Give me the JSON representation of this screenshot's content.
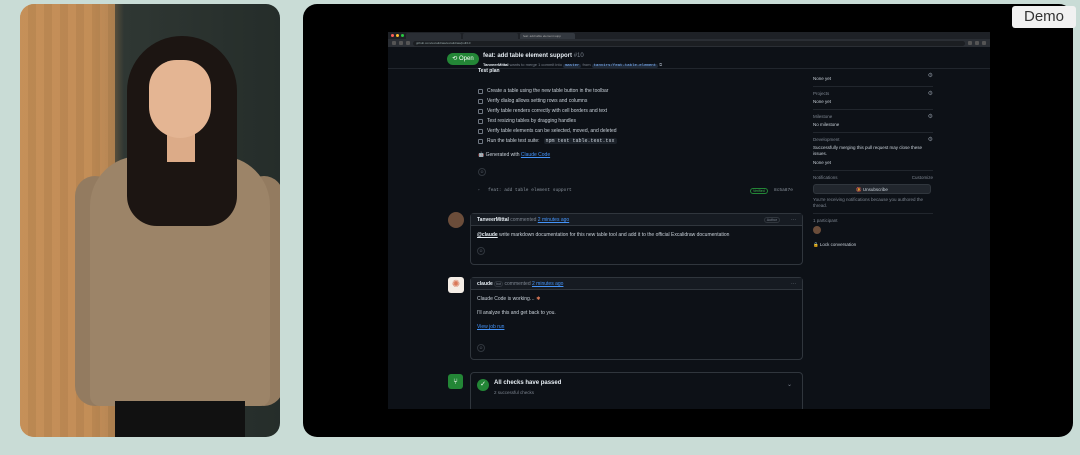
{
  "demo_badge": "Demo",
  "browser": {
    "tabs": [
      "",
      "",
      " feat: add table element supp"
    ],
    "url": "github.com/excalidraw/excalidraw/pull/10"
  },
  "pr": {
    "state": "Open",
    "title": "feat: add table element support",
    "number": "#10",
    "subtitle_author": "TanveerMittal",
    "subtitle_text": "wants to merge 1 commit into",
    "base_branch": "master",
    "from_text": "from",
    "head_branch": "tanvirs/feat-table-element"
  },
  "description": {
    "truncated_heading": "Test plan",
    "checklist": [
      "Create a table using the new table button in the toolbar",
      "Verify dialog allows setting rows and columns",
      "Verify table renders correctly with cell borders and text",
      "Test resizing tables by dragging handles",
      "Verify table elements can be selected, moved, and deleted"
    ],
    "last_item_prefix": "Run the table test suite:",
    "last_item_code": "npm test table.test.tsx",
    "generated_prefix": "🤖 Generated with",
    "generated_link": "Claude Code"
  },
  "commit": {
    "message": "feat: add table element support",
    "verified": "Verified",
    "sha": "8c5a87e"
  },
  "comment1": {
    "author": "TanveerMittal",
    "action": "commented",
    "time": "2 minutes ago",
    "badge": "Author",
    "mention": "@claude",
    "body": "write markdown documentation for this new table tool and add it to the official Excalidraw documentation"
  },
  "comment2": {
    "author": "claude",
    "bot": "bot",
    "action": "commented",
    "time": "2 minutes ago",
    "working": "Claude Code is working…",
    "analyze": "I'll analyze this and get back to you.",
    "link": "View job run"
  },
  "checks": {
    "title": "All checks have passed",
    "subtitle": "2 successful checks"
  },
  "sidebar": {
    "top_value": "None yet",
    "projects_label": "Projects",
    "projects_value": "None yet",
    "milestone_label": "Milestone",
    "milestone_value": "No milestone",
    "development_label": "Development",
    "development_value": "Successfully merging this pull request may close these issues.",
    "development_value2": "None yet",
    "notifications_label": "Notifications",
    "customize": "Customize",
    "unsubscribe": "Unsubscribe",
    "notif_text": "You're receiving notifications because you authored the thread.",
    "participants": "1 participant",
    "lock": "Lock conversation"
  },
  "colors": {
    "accent_green": "#238636",
    "link_blue": "#4493f8",
    "bg_dark": "#0d1117"
  }
}
